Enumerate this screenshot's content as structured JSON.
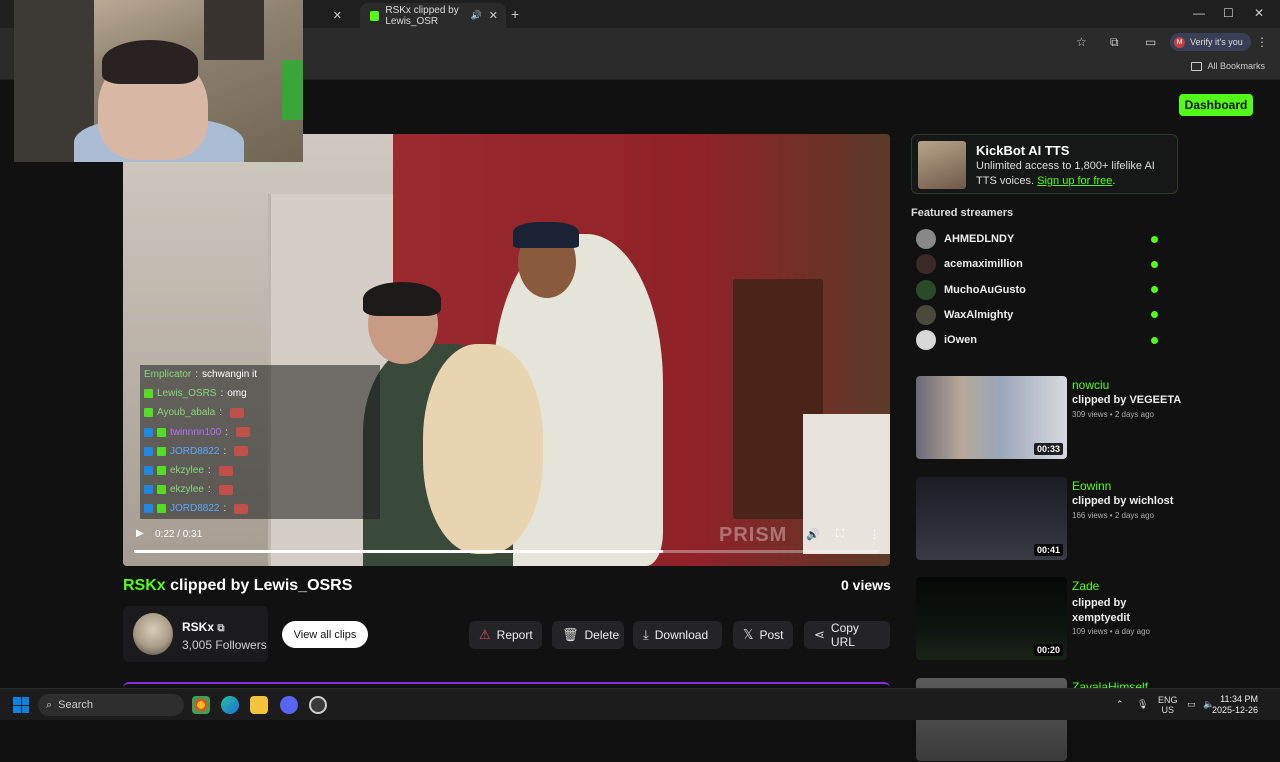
{
  "browser": {
    "tab_title": "RSKx clipped by Lewis_OSR",
    "bookmarks_label": "All Bookmarks",
    "verify_label": "Verify it's you",
    "verify_avatar": "M"
  },
  "header": {
    "dashboard_label": "Dashboard"
  },
  "video": {
    "time": "0:22 / 0:31",
    "progress": 0.71,
    "watermark": "PRISM",
    "chat": [
      {
        "user": "Emplicator",
        "user_color": "#86d77c",
        "msg": "schwangin it"
      },
      {
        "user": "Lewis_OSRS",
        "user_color": "#86d77c",
        "msg": "omg"
      },
      {
        "user": "Ayoub_abala",
        "user_color": "#86d77c",
        "msg": ""
      },
      {
        "user": "twinnnn100",
        "user_color": "#b073ff",
        "msg": ""
      },
      {
        "user": "JORD8822",
        "user_color": "#5aa8ff",
        "msg": ""
      },
      {
        "user": "ekzylee",
        "user_color": "#86d77c",
        "msg": ""
      },
      {
        "user": "ekzylee",
        "user_color": "#86d77c",
        "msg": ""
      },
      {
        "user": "JORD8822",
        "user_color": "#5aa8ff",
        "msg": ""
      }
    ]
  },
  "clip": {
    "channel": "RSKx",
    "title_rest": " clipped by Lewis_OSRS",
    "views": "0 views",
    "followers": "3,005 Followers"
  },
  "actions": {
    "view_all": "View all clips",
    "report": "Report",
    "delete": "Delete",
    "download": "Download",
    "post": "Post",
    "copy_url": "Copy URL"
  },
  "ad": {
    "title": "KickBot AI TTS",
    "desc": "Unlimited access to 1,800+ lifelike AI TTS voices. ",
    "link": "Sign up for free",
    "link_tail": "."
  },
  "featured": {
    "heading": "Featured streamers",
    "items": [
      "AHMEDLNDY",
      "acemaximillion",
      "MuchoAuGusto",
      "WaxAlmighty",
      "iOwen"
    ]
  },
  "clips": [
    {
      "channel": "nowciu",
      "by": "clipped by VEGEETA",
      "meta": "309 views • 2 days ago",
      "duration": "00:33"
    },
    {
      "channel": "Eowinn",
      "by": "clipped by wichlost",
      "meta": "166 views • 2 days ago",
      "duration": "00:41"
    },
    {
      "channel": "Zade",
      "by": "clipped by xemptyedit",
      "meta": "109 views • a day ago",
      "duration": "00:20"
    },
    {
      "channel": "ZavalaHimself",
      "by": "",
      "meta": "",
      "duration": ""
    }
  ],
  "taskbar": {
    "search": "Search",
    "lang": "ENG",
    "region": "US",
    "time": "11:34 PM",
    "date": "2025-12-26"
  },
  "colors": {
    "accent": "#53fc18",
    "background": "#111112"
  }
}
